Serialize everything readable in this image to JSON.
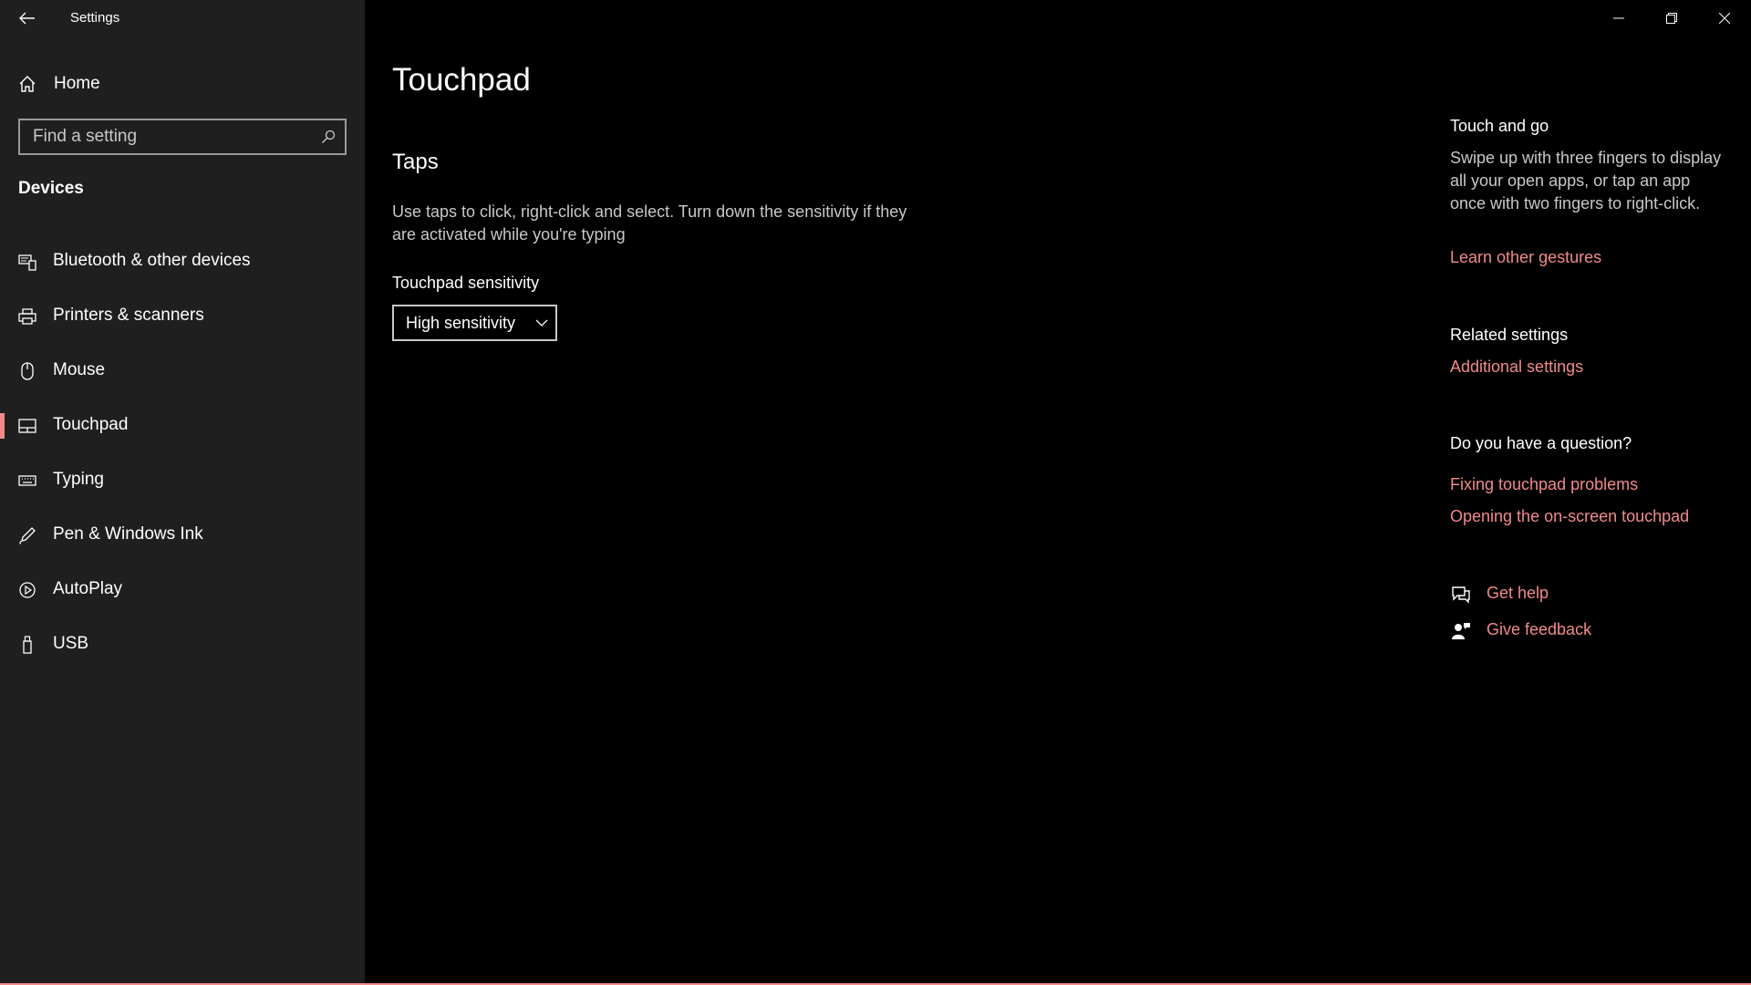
{
  "window": {
    "app_title": "Settings",
    "accent_color": "#f08a8a",
    "controls": [
      "minimize-icon",
      "restore-icon",
      "close-icon"
    ]
  },
  "sidebar": {
    "home_label": "Home",
    "search": {
      "placeholder": "Find a setting",
      "value": ""
    },
    "section_title": "Devices",
    "items": [
      {
        "label": "Bluetooth & other devices",
        "icon": "bluetooth-devices-icon",
        "selected": false
      },
      {
        "label": "Printers & scanners",
        "icon": "printer-icon",
        "selected": false
      },
      {
        "label": "Mouse",
        "icon": "mouse-icon",
        "selected": false
      },
      {
        "label": "Touchpad",
        "icon": "touchpad-icon",
        "selected": true
      },
      {
        "label": "Typing",
        "icon": "keyboard-icon",
        "selected": false
      },
      {
        "label": "Pen & Windows Ink",
        "icon": "pen-icon",
        "selected": false
      },
      {
        "label": "AutoPlay",
        "icon": "autoplay-icon",
        "selected": false
      },
      {
        "label": "USB",
        "icon": "usb-icon",
        "selected": false
      }
    ]
  },
  "main": {
    "page_title": "Touchpad",
    "taps": {
      "heading": "Taps",
      "description": "Use taps to click, right-click and select. Turn down the sensitivity if they are activated while you're typing",
      "sensitivity_label": "Touchpad sensitivity",
      "sensitivity_value": "High sensitivity"
    }
  },
  "aside": {
    "touch_and_go": {
      "heading": "Touch and go",
      "text": "Swipe up with three fingers to display all your open apps, or tap an app once with two fingers to right-click.",
      "link": "Learn other gestures"
    },
    "related": {
      "heading": "Related settings",
      "link": "Additional settings"
    },
    "question": {
      "heading": "Do you have a question?",
      "links": [
        "Fixing touchpad problems",
        "Opening the on-screen touchpad"
      ]
    },
    "help": {
      "get_help": "Get help",
      "give_feedback": "Give feedback"
    }
  }
}
